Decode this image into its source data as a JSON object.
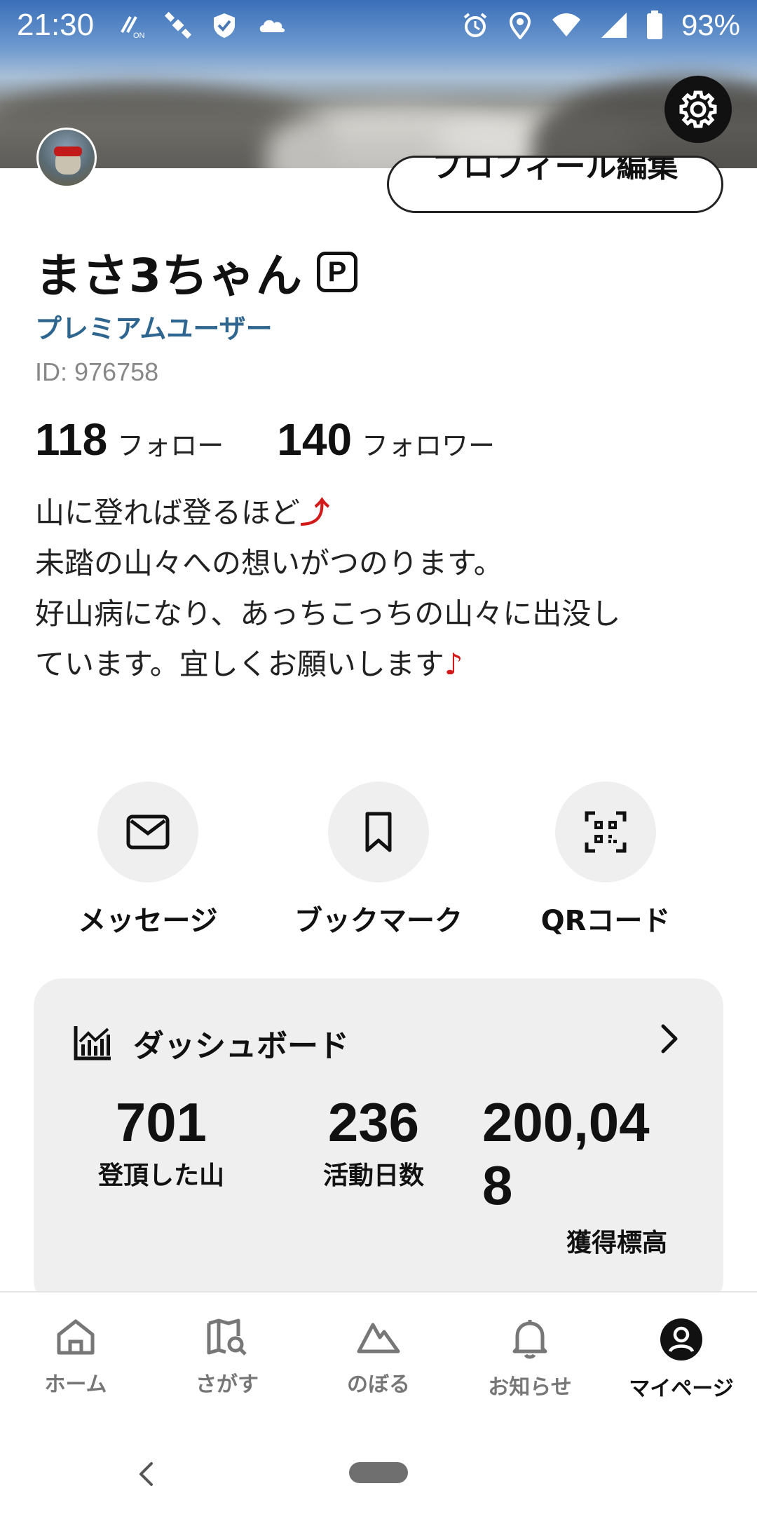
{
  "status_bar": {
    "time": "21:30",
    "battery": "93%",
    "icons": [
      "nfc-on-icon",
      "satellite-icon",
      "shield-check-icon",
      "cloud-icon",
      "alarm-icon",
      "location-icon",
      "wifi-icon",
      "signal-icon",
      "battery-icon"
    ]
  },
  "header": {
    "settings_icon": "gear-icon",
    "edit_profile_label": "プロフィール編集"
  },
  "profile": {
    "name": "まさ3ちゃん",
    "badge": "P",
    "membership": "プレミアムユーザー",
    "id_text": "ID: 976758",
    "following_count": "118",
    "following_label": "フォロー",
    "followers_count": "140",
    "followers_label": "フォロワー",
    "bio_lines": [
      "山に登れば登るほど",
      "未踏の山々への想いがつのります。",
      "好山病になり、あっちこっちの山々に出没し",
      "ています。宜しくお願いします"
    ],
    "bio_emoji_1": "⤴",
    "bio_emoji_2": "♪"
  },
  "actions": {
    "message": "メッセージ",
    "bookmark": "ブックマーク",
    "qr": "QRコード"
  },
  "dashboard": {
    "title": "ダッシュボード",
    "stats": [
      {
        "value": "701",
        "label": "登頂した山"
      },
      {
        "value": "236",
        "label": "活動日数"
      },
      {
        "value_line1": "200,04",
        "value_line2": "8",
        "label": "獲得標高"
      }
    ]
  },
  "bottom_nav": {
    "home": "ホーム",
    "search": "さがす",
    "climb": "のぼる",
    "notifications": "お知らせ",
    "mypage": "マイページ",
    "active": "mypage"
  }
}
